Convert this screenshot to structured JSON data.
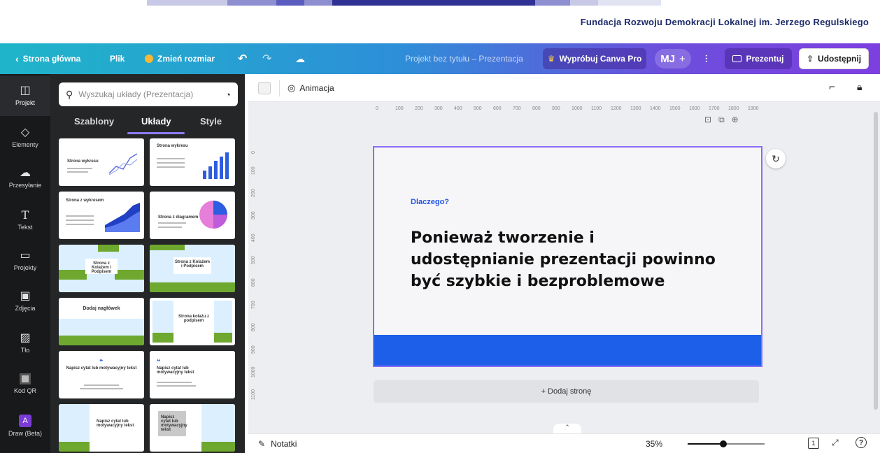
{
  "brand": {
    "foundation_name": "Fundacja Rozwoju Demokracji Lokalnej im. Jerzego Regulskiego",
    "band_colors": [
      "#c8c9e6",
      "#8d8fd0",
      "#2f3194",
      "#1f2070",
      "#5a5cc0"
    ]
  },
  "header": {
    "home_label": "Strona główna",
    "file_label": "Plik",
    "resize_label": "Zmień rozmiar",
    "doc_title": "Projekt bez tytułu – Prezentacja",
    "try_pro_label": "Wypróbuj Canva Pro",
    "user_initials": "MJ",
    "present_label": "Prezentuj",
    "share_label": "Udostępnij"
  },
  "rail": {
    "items": [
      {
        "label": "Projekt",
        "icon": "layout-icon"
      },
      {
        "label": "Elementy",
        "icon": "shapes-icon"
      },
      {
        "label": "Przesyłanie",
        "icon": "upload-icon"
      },
      {
        "label": "Tekst",
        "icon": "text-icon"
      },
      {
        "label": "Projekty",
        "icon": "folder-icon"
      },
      {
        "label": "Zdjęcia",
        "icon": "image-icon"
      },
      {
        "label": "Tło",
        "icon": "background-icon"
      },
      {
        "label": "Kod QR",
        "icon": "qr-icon"
      },
      {
        "label": "Draw (Beta)",
        "icon": "draw-icon"
      }
    ]
  },
  "panel": {
    "search_placeholder": "Wyszukaj układy (Prezentacja)",
    "tabs": [
      "Szablony",
      "Układy",
      "Style"
    ],
    "active_tab": "Układy",
    "thumbs": [
      {
        "title": "Strona wykresu"
      },
      {
        "title": "Strona wykresu"
      },
      {
        "title": "Strona z wykresem"
      },
      {
        "title": "Strona z diagramem"
      },
      {
        "title": "Strona z Kolażem i Podpisem"
      },
      {
        "title": "Strona z Kolażem i Podpisem"
      },
      {
        "title": "Dodaj nagłówek"
      },
      {
        "title": "Strona kolażu z podpisem"
      },
      {
        "title": "Napisz cytat lub motywacyjny tekst"
      },
      {
        "title": "Napisz cytat lub motywacyjny tekst"
      },
      {
        "title": "Napisz cytat lub motywacyjny tekst"
      },
      {
        "title": "Napisz cytat lub motywacyjny tekst"
      }
    ]
  },
  "toolbar": {
    "animation_label": "Animacja"
  },
  "ruler": {
    "h_ticks": [
      "0",
      "100",
      "200",
      "300",
      "400",
      "500",
      "600",
      "700",
      "800",
      "900",
      "1000",
      "1100",
      "1200",
      "1300",
      "1400",
      "1500",
      "1600",
      "1700",
      "1800",
      "1900"
    ],
    "v_ticks": [
      "0",
      "100",
      "200",
      "300",
      "400",
      "500",
      "600",
      "700",
      "800",
      "900",
      "1000",
      "1100"
    ]
  },
  "slide": {
    "eyebrow": "Dlaczego?",
    "title": "Ponieważ tworzenie i udostępnianie prezentacji powinno być szybkie i bezproblemowe",
    "bar_color": "#1d5fe8"
  },
  "editor": {
    "add_page_label": "+ Dodaj stronę"
  },
  "footer": {
    "notes_label": "Notatki",
    "zoom_label": "35%",
    "zoom_fraction": 0.35,
    "page_count": "1"
  }
}
